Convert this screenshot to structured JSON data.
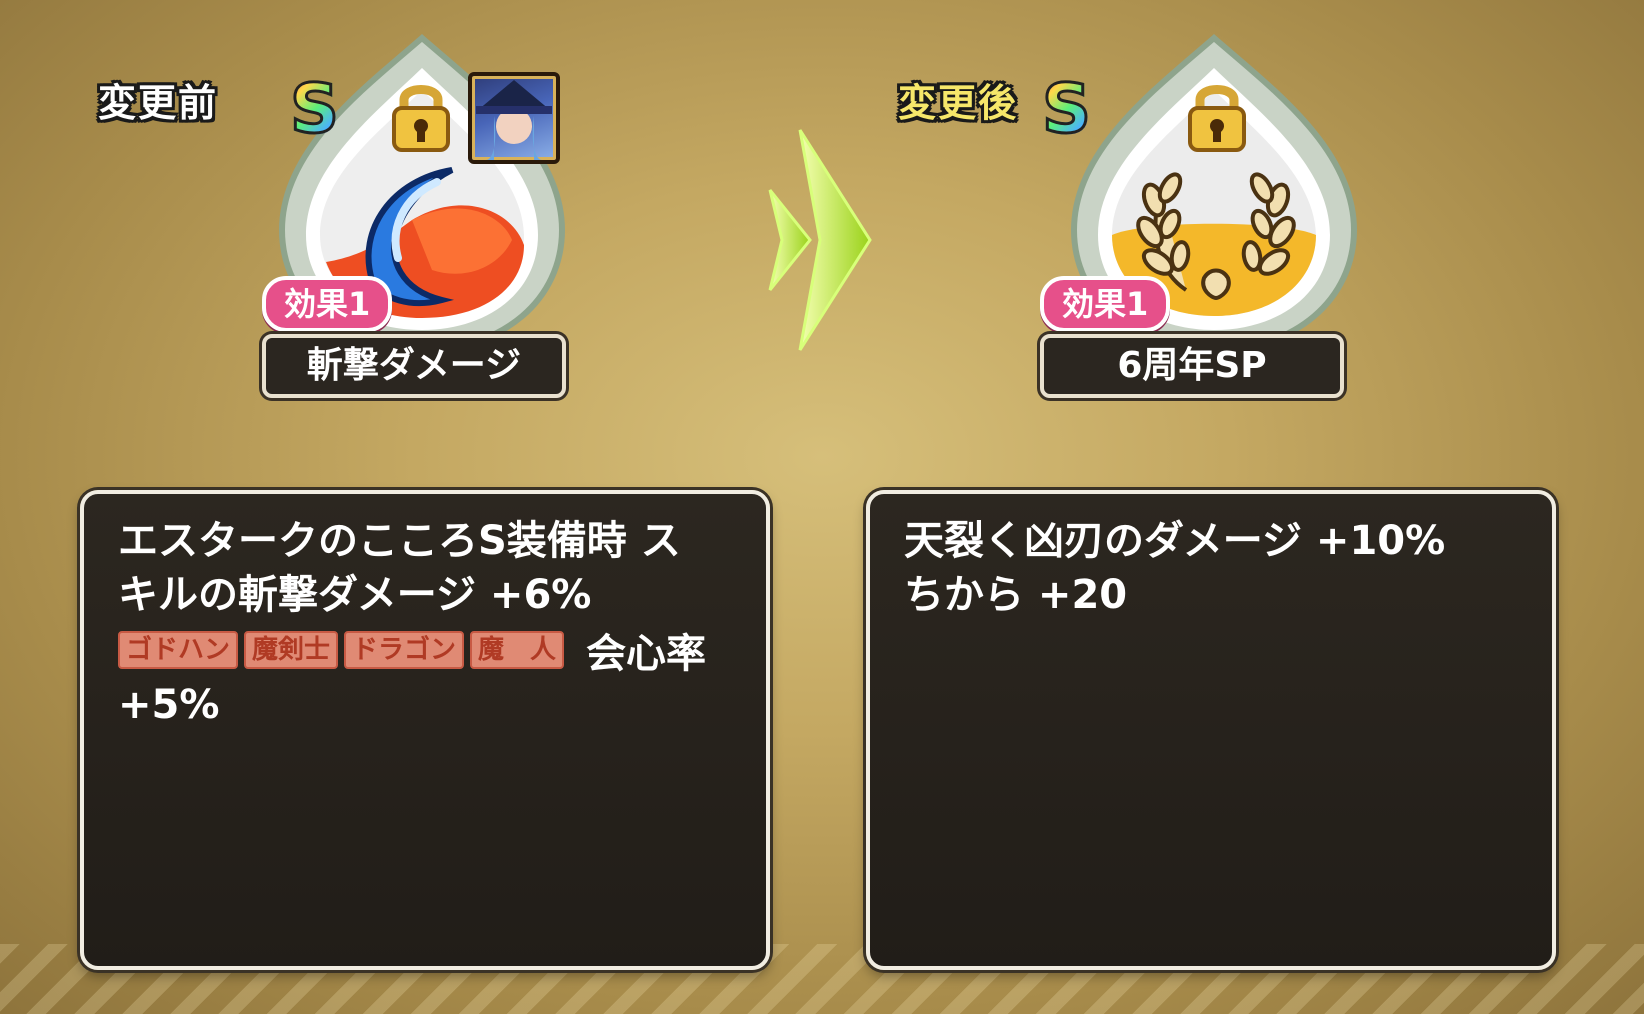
{
  "before": {
    "header": "変更前",
    "rank": "S",
    "effect_label": "効果1",
    "name": "斬撃ダメージ",
    "icons": [
      "lock-icon",
      "character-portrait",
      "crescent-slash-icon"
    ],
    "description_lines": [
      "エスタークのこころS装備時 ス",
      "キルの斬撃ダメージ +6%"
    ],
    "tags": [
      "ゴドハン",
      "魔剣士",
      "ドラゴン",
      "魔　人"
    ],
    "tag_stat": "会心率",
    "last_line": "+5%"
  },
  "after": {
    "header": "変更後",
    "rank": "S",
    "effect_label": "効果1",
    "name": "6周年SP",
    "icons": [
      "lock-icon",
      "laurel-wreath-icon"
    ],
    "description_lines": [
      "天裂く凶刃のダメージ +10%",
      "ちから +20"
    ]
  },
  "colors": {
    "tag_bg": "#e08a74",
    "effect_pill": "#e6508a",
    "arrow": "#b8f03a",
    "after_header": "#f6e76a"
  }
}
